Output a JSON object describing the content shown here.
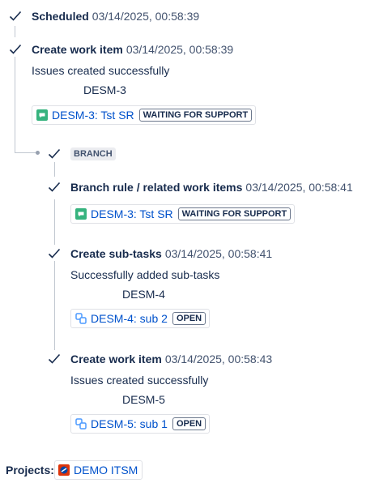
{
  "steps": {
    "scheduled": {
      "title": "Scheduled",
      "timestamp": "03/14/2025, 00:58:39"
    },
    "create1": {
      "title": "Create work item",
      "timestamp": "03/14/2025, 00:58:39",
      "message": "Issues created successfully",
      "key": "DESM-3",
      "chip": {
        "link": "DESM-3: Tst SR",
        "status": "WAITING FOR SUPPORT",
        "icon": "service-request-icon"
      }
    },
    "branch": {
      "tag": "BRANCH"
    },
    "branch_rule": {
      "title": "Branch rule / related work items",
      "timestamp": "03/14/2025, 00:58:41",
      "chip": {
        "link": "DESM-3: Tst SR",
        "status": "WAITING FOR SUPPORT",
        "icon": "service-request-icon"
      }
    },
    "subtasks": {
      "title": "Create sub-tasks",
      "timestamp": "03/14/2025, 00:58:41",
      "message": "Successfully added sub-tasks",
      "key": "DESM-4",
      "chip": {
        "link": "DESM-4: sub 2",
        "status": "OPEN",
        "icon": "subtask-icon"
      }
    },
    "create2": {
      "title": "Create work item",
      "timestamp": "03/14/2025, 00:58:43",
      "message": "Issues created successfully",
      "key": "DESM-5",
      "chip": {
        "link": "DESM-5: sub 1",
        "status": "OPEN",
        "icon": "subtask-icon"
      }
    }
  },
  "projects": {
    "label": "Projects:",
    "name": "DEMO ITSM",
    "icon": "project-avatar-icon"
  },
  "colors": {
    "link": "#0052cc",
    "check": "#172b4d",
    "line": "#c1c7d0",
    "sr_green": "#36b37e",
    "subtask_blue": "#4c9aff"
  }
}
